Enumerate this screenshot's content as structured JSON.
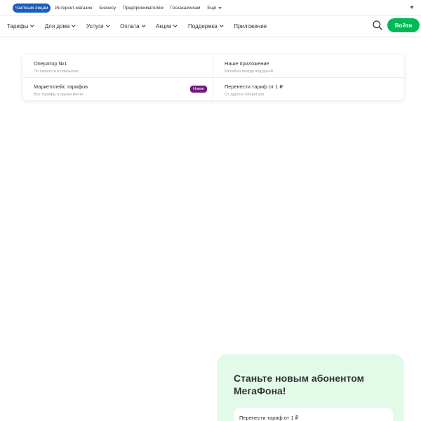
{
  "segments": {
    "items": [
      {
        "label": "Частным лицам",
        "active": true
      },
      {
        "label": "Интернет-магазин"
      },
      {
        "label": "Бизнесу"
      },
      {
        "label": "Предпринимателям"
      },
      {
        "label": "Госзаказчикам"
      },
      {
        "label": "Ещё"
      }
    ],
    "location_icon": "location-arrow-icon"
  },
  "nav": {
    "items": [
      "Тарифы",
      "Для дома",
      "Услуги",
      "Оплата",
      "Акции",
      "Поддержка",
      "Приложение"
    ],
    "search_icon": "search-icon",
    "login_label": "Войти"
  },
  "menu": {
    "cells": [
      {
        "title": "Оператор №1",
        "subtitle": "По скорости и покрытию"
      },
      {
        "title": "Наше приложение",
        "subtitle": "МегаФон всегда под рукой"
      },
      {
        "title": "Маркетплейс тарифов",
        "subtitle": "Все тарифы в одном месте",
        "badge": "Новое"
      },
      {
        "title": "Перенести тариф от 1 ₽",
        "subtitle": "От другого оператора"
      }
    ]
  },
  "promo": {
    "title": "Станьте новым абонентом МегаФона!",
    "card_title": "Перенести тариф от 1 ₽"
  },
  "colors": {
    "brand_green": "#00b956",
    "segment_active": "#1f5cb6",
    "badge_purple": "#731982",
    "promo_bg": "#e2fbe9"
  }
}
